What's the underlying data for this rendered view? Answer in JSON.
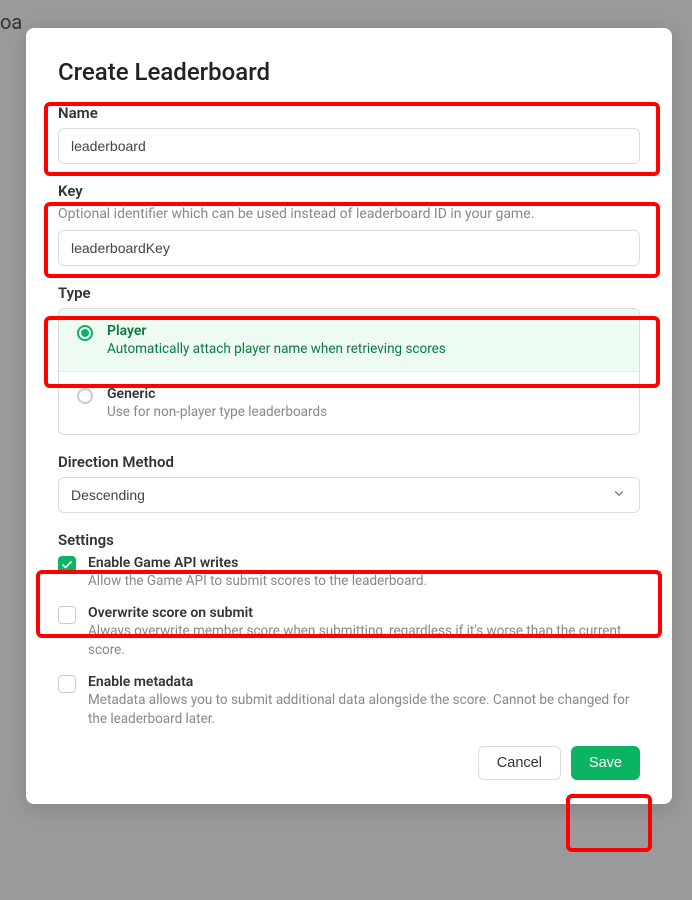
{
  "background_text": "oa",
  "modal": {
    "title": "Create Leaderboard",
    "name": {
      "label": "Name",
      "value": "leaderboard"
    },
    "key": {
      "label": "Key",
      "hint": "Optional identifier which can be used instead of leaderboard ID in your game.",
      "value": "leaderboardKey"
    },
    "type": {
      "label": "Type",
      "options": [
        {
          "title": "Player",
          "desc": "Automatically attach player name when retrieving scores",
          "selected": true
        },
        {
          "title": "Generic",
          "desc": "Use for non-player type leaderboards",
          "selected": false
        }
      ]
    },
    "direction": {
      "label": "Direction Method",
      "value": "Descending"
    },
    "settings": {
      "label": "Settings",
      "items": [
        {
          "title": "Enable Game API writes",
          "desc": "Allow the Game API to submit scores to the leaderboard.",
          "checked": true
        },
        {
          "title": "Overwrite score on submit",
          "desc": "Always overwrite member score when submitting, regardless if it's worse than the current score.",
          "checked": false
        },
        {
          "title": "Enable metadata",
          "desc": "Metadata allows you to submit additional data alongside the score. Cannot be changed for the leaderboard later.",
          "checked": false
        }
      ]
    },
    "actions": {
      "cancel": "Cancel",
      "save": "Save"
    }
  }
}
